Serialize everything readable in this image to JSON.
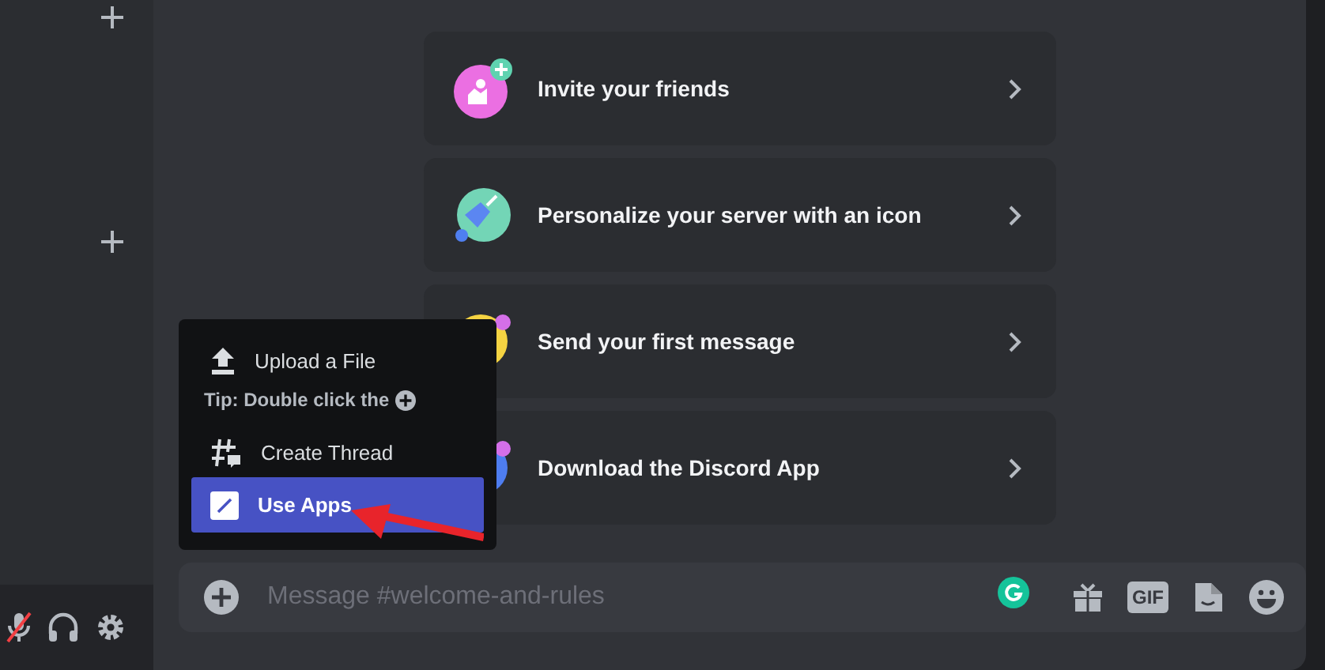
{
  "user_panel": {
    "mic_muted": true
  },
  "checklist": [
    {
      "kind": "invite",
      "label": "Invite your friends"
    },
    {
      "kind": "personalize",
      "label": "Personalize your server with an icon"
    },
    {
      "kind": "message",
      "label": "Send your first message"
    },
    {
      "kind": "download",
      "label": "Download the Discord App"
    }
  ],
  "attach_menu": {
    "items": [
      {
        "kind": "upload",
        "label": "Upload a File",
        "selected": false
      },
      {
        "kind": "tip",
        "label": "Tip: Double click the"
      },
      {
        "kind": "thread",
        "label": "Create Thread",
        "selected": false
      },
      {
        "kind": "apps",
        "label": "Use Apps",
        "selected": true
      }
    ]
  },
  "composer": {
    "placeholder": "Message #welcome-and-rules",
    "gif_label": "GIF"
  }
}
